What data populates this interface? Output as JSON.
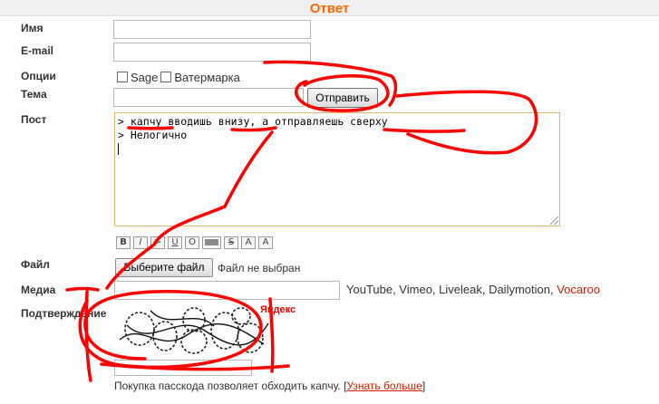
{
  "header": {
    "title": "Ответ"
  },
  "form": {
    "name_label": "Имя",
    "email_label": "E-mail",
    "options_label": "Опции",
    "option_sage": "Sage",
    "option_watermark": "Ватермарка",
    "subject_label": "Тема",
    "submit_label": "Отправить",
    "post_label": "Пост",
    "post_lines": [
      "> капчу вводишь внизу, а отправляешь сверху",
      "> Нелогично"
    ],
    "formatting_buttons": [
      "B",
      "I",
      ">",
      "U",
      "O",
      "spoiler",
      "S",
      "A",
      "A"
    ],
    "file_label": "Файл",
    "file_button": "Выберите файл",
    "file_status": "Файл не выбран",
    "media_label": "Медиа",
    "media_hosts_text": "YouTube, Vimeo, Liveleak, Dailymotion,",
    "media_link": "Vocaroo",
    "confirm_label": "Подтверждение",
    "captcha_brand": "Яндекс",
    "pass_note": "Покупка пасскода позволяет обходить капчу. [",
    "pass_link": "Узнать больше",
    "pass_note_end": "]"
  },
  "colors": {
    "accent": "#ff6600",
    "link": "#cc2200",
    "annotation": "#ff0000"
  }
}
